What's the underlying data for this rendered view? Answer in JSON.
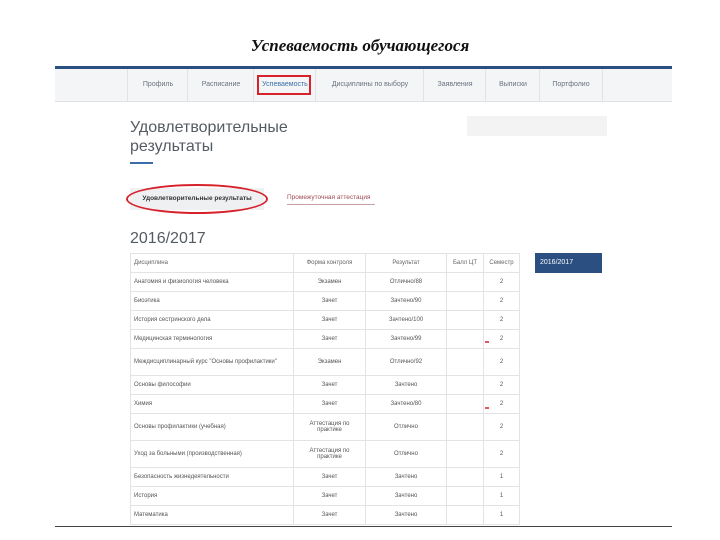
{
  "slide_title": "Успеваемость обучающегося",
  "nav": {
    "items": [
      {
        "label": "Профиль",
        "active": false
      },
      {
        "label": "Расписание",
        "active": false
      },
      {
        "label": "Успеваемость",
        "active": true
      },
      {
        "label": "Дисциплины по выбору",
        "active": false
      },
      {
        "label": "Заявления",
        "active": false
      },
      {
        "label": "Выписки",
        "active": false
      },
      {
        "label": "Портфолио",
        "active": false
      }
    ]
  },
  "page": {
    "heading_line1": "Удовлетворительные",
    "heading_line2": "результаты",
    "tab_active": "Удовлетворительные результаты",
    "tab_other": "Промежуточная аттестация",
    "year": "2016/2017",
    "year_button": "2016/2017"
  },
  "table": {
    "headers": [
      "Дисциплина",
      "Форма контроля",
      "Результат",
      "Балл ЦТ",
      "Семестр"
    ],
    "rows": [
      [
        "Анатомия и физиология человека",
        "Экзамен",
        "Отлично/88",
        "",
        "2"
      ],
      [
        "Биоэтика",
        "Зачет",
        "Зачтено/90",
        "",
        "2"
      ],
      [
        "История сестринского дела",
        "Зачет",
        "Зачтено/100",
        "",
        "2"
      ],
      [
        "Медицинская терминология",
        "Зачет",
        "Зачтено/99",
        "",
        "2"
      ],
      [
        "Междисциплинарный курс \"Основы профилактики\"",
        "Экзамен",
        "Отлично/92",
        "",
        "2"
      ],
      [
        "Основы философии",
        "Зачет",
        "Зачтено",
        "",
        "2"
      ],
      [
        "Химия",
        "Зачет",
        "Зачтено/80",
        "",
        "2"
      ],
      [
        "Основы профилактики (учебная)",
        "Аттестация по практике",
        "Отлично",
        "",
        "2"
      ],
      [
        "Уход за больными (производственная)",
        "Аттестация по практике",
        "Отлично",
        "",
        "2"
      ],
      [
        "Безопасность жизнедеятельности",
        "Зачет",
        "Зачтено",
        "",
        "1"
      ],
      [
        "История",
        "Зачет",
        "Зачтено",
        "",
        "1"
      ],
      [
        "Математика",
        "Зачет",
        "Зачтено",
        "",
        "1"
      ]
    ]
  },
  "colors": {
    "accent": "#2a4f80",
    "highlight_ring": "#d7212b"
  }
}
